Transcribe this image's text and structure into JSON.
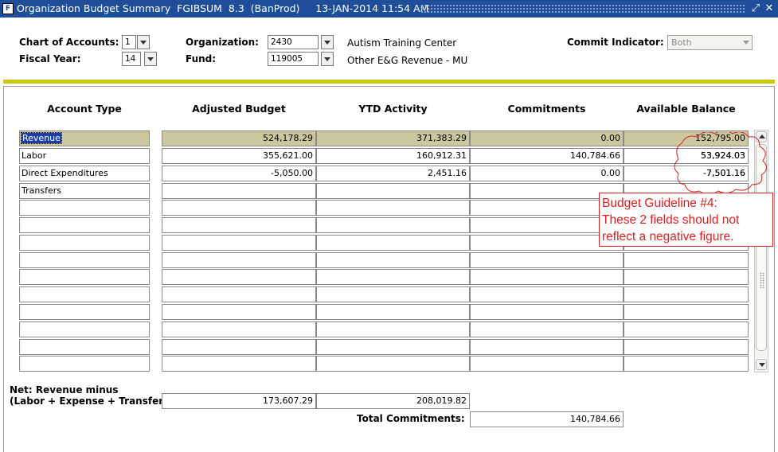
{
  "window": {
    "title": "Organization Budget Summary  FGIBSUM  8.3  (BanProd)     13-JAN-2014 11:54 AM"
  },
  "key_block": {
    "chart_label": "Chart of Accounts:",
    "chart_value": "1",
    "fiscal_label": "Fiscal Year:",
    "fiscal_value": "14",
    "org_label": "Organization:",
    "org_value": "2430",
    "org_desc": "Autism Training Center",
    "fund_label": "Fund:",
    "fund_value": "119005",
    "fund_desc": "Other E&G Revenue - MU",
    "commit_label": "Commit Indicator:",
    "commit_value": "Both"
  },
  "table": {
    "headers": [
      "Account Type",
      "Adjusted Budget",
      "YTD Activity",
      "Commitments",
      "Available Balance"
    ],
    "rows": [
      {
        "type": "Revenue",
        "budget": "524,178.29",
        "ytd": "371,383.29",
        "commit": "0.00",
        "avail": "152,795.00"
      },
      {
        "type": "Labor",
        "budget": "355,621.00",
        "ytd": "160,912.31",
        "commit": "140,784.66",
        "avail": "53,924.03"
      },
      {
        "type": "Direct Expenditures",
        "budget": "-5,050.00",
        "ytd": "2,451.16",
        "commit": "0.00",
        "avail": "-7,501.16"
      },
      {
        "type": "Transfers",
        "budget": "",
        "ytd": "",
        "commit": "",
        "avail": ""
      }
    ]
  },
  "net": {
    "label_line1": "Net:  Revenue minus",
    "label_line2": "(Labor + Expense + Transfer)",
    "budget": "173,607.29",
    "ytd": "208,019.82",
    "total_commit_label": "Total Commitments:",
    "total_commit": "140,784.66"
  },
  "annotation": {
    "line1": "Budget Guideline #4:",
    "line2": "These 2 fields should not",
    "line3": "reflect a negative figure.",
    "color": "#e02020"
  },
  "colors": {
    "titlebar": "#1e4d9a",
    "separator": "#c9c912",
    "highlight_row": "#cbc8a0",
    "selection": "#1b3fa6"
  }
}
